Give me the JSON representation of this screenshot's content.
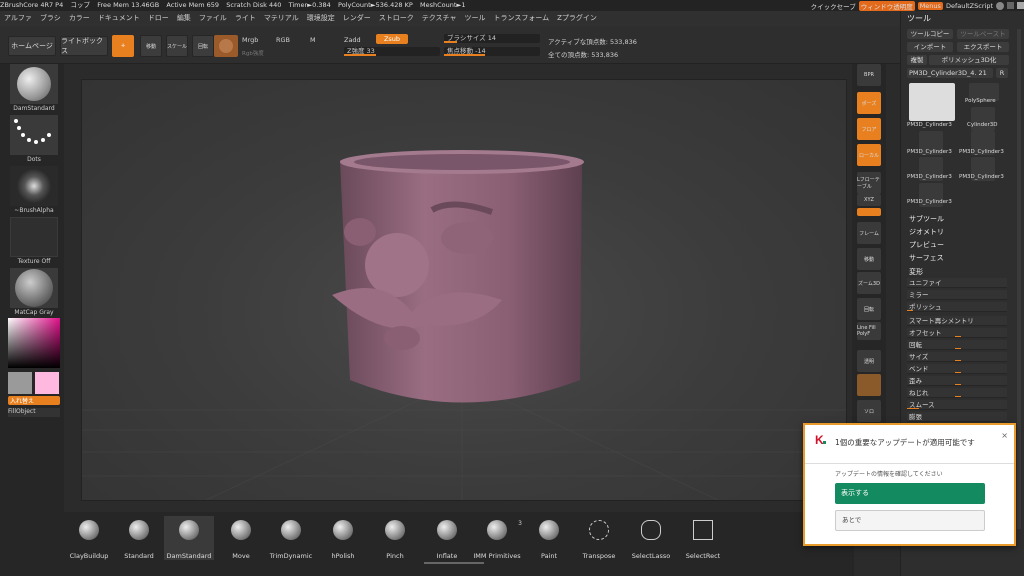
{
  "titlebar": {
    "app": "ZBrushCore 4R7 P4",
    "copy": "コップ",
    "free_mem": "Free Mem 13.46GB",
    "active_mem": "Active Mem 659",
    "scratch": "Scratch Disk 440",
    "timer": "Timer►0.384",
    "poly": "PolyCount►536.428 KP",
    "mesh": "MeshCount►1",
    "quicksave": "クイックセーブ",
    "window_transparency": "ウィンドウ透明度",
    "menus": "Menus",
    "script": "DefaultZScript"
  },
  "menubar": [
    "アルファ",
    "ブラシ",
    "カラー",
    "ドキュメント",
    "ドロー",
    "編集",
    "ファイル",
    "ライト",
    "マテリアル",
    "環境設定",
    "レンダー",
    "ストローク",
    "テクスチャ",
    "ツール",
    "トランスフォーム",
    "Zプラグイン"
  ],
  "toolbar": {
    "home": "ホームページ",
    "lightbox": "ライトボックス",
    "edit": "ドロー",
    "move": "移動",
    "scale": "スケール",
    "rotate": "回転",
    "mrgb": "Mrgb",
    "rgb": "RGB",
    "m": "M",
    "rgb_intensity": "Rgb強度",
    "zadd": "Zadd",
    "zsub": "Zsub",
    "z_intensity": "Z強度 33",
    "brush_size": "ブラシサイズ 14",
    "focal_shift": "焦点移動 -14",
    "active_points": "アクティブな頂点数: 533,836",
    "total_points": "全ての頂点数: 533,836"
  },
  "leftshelf": {
    "brush": "DamStandard",
    "stroke": "Dots",
    "alpha": "~BrushAlpha",
    "texture": "Texture Off",
    "material": "MatCap Gray",
    "swap": "入れ替え",
    "fill": "FillObject"
  },
  "rightshelf": [
    "BPR",
    "ポーズ",
    "フロア",
    "ローカル",
    "Lフローテーブル",
    "XYZ",
    "",
    "フレーム",
    "移動",
    "ズーム3D",
    "回転",
    "Line Fill PolyF",
    "透明",
    "",
    "ソロ"
  ],
  "bottomshelf": [
    {
      "name": "ClayBuildup"
    },
    {
      "name": "Standard"
    },
    {
      "name": "DamStandard"
    },
    {
      "name": "Move"
    },
    {
      "name": "TrimDynamic"
    },
    {
      "name": "hPolish"
    },
    {
      "name": "Pinch"
    },
    {
      "name": "Inflate"
    },
    {
      "name": "IMM Primitives",
      "badge": "3"
    },
    {
      "name": "Paint"
    },
    {
      "name": "Transpose"
    },
    {
      "name": "SelectLasso"
    },
    {
      "name": "SelectRect"
    }
  ],
  "toolpanel": {
    "title": "ツール",
    "copy": "ツールコピー",
    "paste": "ツールペースト",
    "import": "インポート",
    "export": "エクスポート",
    "clone": "複製",
    "polymesh": "ポリメッシュ3D化",
    "current": "PM3D_Cylinder3D_4. 21",
    "r": "R",
    "thumbs": [
      "PM3D_Cylinder3",
      "PolySphere",
      "Cylinder3D",
      "PM3D_Cylinder3",
      "PM3D_Cylinder3",
      "PM3D_Cylinder3",
      "PM3D_Cylinder3",
      "PM3D_Cylinder3"
    ],
    "sections": [
      "サブツール",
      "ジオメトリ",
      "プレビュー",
      "サーフェス"
    ],
    "deform_title": "変形",
    "props": [
      "ユニファイ",
      "ミラー",
      "ポリッシュ",
      "スマート再シメントリ",
      "オフセット",
      "回転",
      "サイズ",
      "ベンド",
      "歪み",
      "ねじれ",
      "スムース",
      "膨張"
    ]
  },
  "notification": {
    "title": "1個の重要なアップデートが適用可能です",
    "body": "アップデートの情報を確認してください",
    "primary": "表示する",
    "secondary": "あとで"
  },
  "colors": {
    "accent": "#e8801f",
    "notif_primary": "#138a5f",
    "model": "#9a6d82"
  }
}
